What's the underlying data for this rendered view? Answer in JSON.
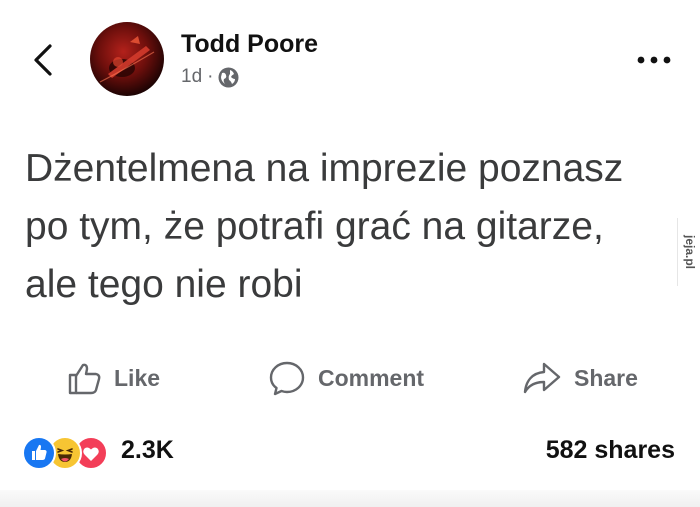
{
  "post": {
    "author": "Todd Poore",
    "age": "1d",
    "separator": "·",
    "audience_icon": "globe-icon",
    "text": "Dżentelmena na imprezie poznasz po tym, że potrafi grać na gitarze, ale tego nie robi"
  },
  "actions": {
    "like": "Like",
    "comment": "Comment",
    "share": "Share"
  },
  "stats": {
    "reactions": [
      "like-reaction-icon",
      "haha-reaction-icon",
      "love-reaction-icon"
    ],
    "reaction_count": "2.3K",
    "shares": "582 shares"
  },
  "watermark": {
    "text": "jeja.pl"
  },
  "colors": {
    "like_blue": "#1877f2",
    "haha_yellow": "#f7c533",
    "love_red": "#f33e58",
    "secondary_text": "#65676b"
  }
}
